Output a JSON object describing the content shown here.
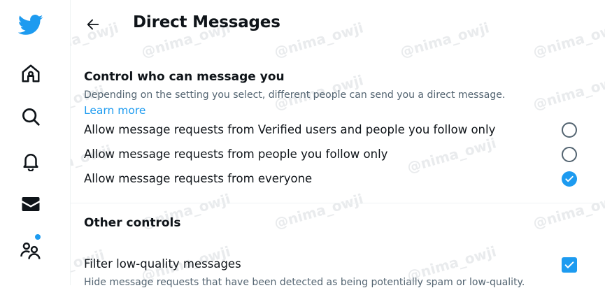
{
  "header": {
    "title": "Direct Messages"
  },
  "section_control": {
    "title": "Control who can message you",
    "description": "Depending on the setting you select, different people can send you a direct message.",
    "learn_more": "Learn more",
    "options": [
      {
        "label": "Allow message requests from Verified users and people you follow only",
        "selected": false
      },
      {
        "label": "Allow message requests from people you follow only",
        "selected": false
      },
      {
        "label": "Allow message requests from everyone",
        "selected": true
      }
    ]
  },
  "section_other": {
    "title": "Other controls",
    "filter": {
      "label": "Filter low-quality messages",
      "checked": true,
      "description": "Hide message requests that have been detected as being potentially spam or low-quality."
    }
  },
  "watermark": "@nima_owji",
  "colors": {
    "accent": "#1d9bf0",
    "text": "#0f1419",
    "secondary": "#536471",
    "divider": "#eff3f4"
  },
  "sidebar_icons": [
    "twitter-logo-icon",
    "home-icon",
    "search-icon",
    "notifications-bell-icon",
    "messages-envelope-icon",
    "communities-icon"
  ]
}
